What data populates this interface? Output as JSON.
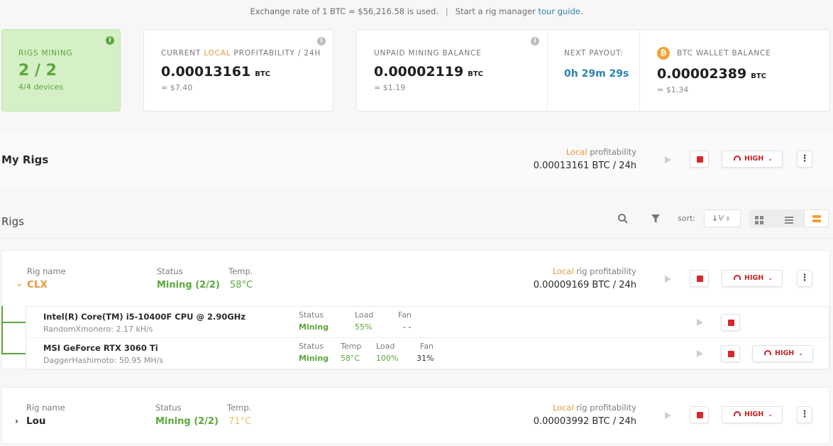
{
  "topbar": {
    "rate_text": "Exchange rate of 1 BTC ≈ $56,216.58 is used.",
    "tour_prefix": "Start a rig manager",
    "tour_link": "tour guide",
    "tour_suffix": "."
  },
  "stats": {
    "rigs_mining": {
      "label": "RIGS MINING",
      "value": "2 / 2",
      "devices": "4/4 devices"
    },
    "profitability": {
      "label_prefix": "CURRENT",
      "label_local": "LOCAL",
      "label_suffix": "PROFITABILITY / 24H",
      "value": "0.00013161",
      "unit": "BTC",
      "usd": "≈ $7.40"
    },
    "unpaid": {
      "label": "UNPAID MINING BALANCE",
      "value": "0.00002119",
      "unit": "BTC",
      "usd": "≈ $1.19"
    },
    "payout": {
      "label": "NEXT PAYOUT:",
      "value": "0h 29m 29s"
    },
    "wallet": {
      "label": "BTC WALLET BALANCE",
      "value": "0.00002389",
      "unit": "BTC",
      "usd": "≈ $1.34",
      "icon": "bitcoin-icon"
    }
  },
  "myrigs": {
    "title": "My Rigs",
    "local": "Local",
    "profit_label": "profitability",
    "profit_value": "0.00013161 BTC / 24h",
    "power": "HIGH"
  },
  "rigs_bar": {
    "title": "Rigs",
    "sort_label": "sort:"
  },
  "rigs": [
    {
      "name_label": "Rig name",
      "name": "CLX",
      "status_label": "Status",
      "status": "Mining (2/2)",
      "temp_label": "Temp.",
      "temp": "58°C",
      "local": "Local",
      "profit_label": "rig profitability",
      "profit": "0.00009169 BTC / 24h",
      "power": "HIGH",
      "devices": [
        {
          "name": "Intel(R) Core(TM) i5-10400F CPU @ 2.90GHz",
          "algo": "RandomXmonero: 2.17 kH/s",
          "status_label": "Status",
          "status": "Mining",
          "load_label": "Load",
          "load": "55%",
          "fan_label": "Fan",
          "fan": "- -"
        },
        {
          "name": "MSI GeForce RTX 3060 Ti",
          "algo": "DaggerHashimoto: 50.95 MH/s",
          "status_label": "Status",
          "status": "Mining",
          "temp_label": "Temp",
          "temp": "58°C",
          "load_label": "Load",
          "load": "100%",
          "fan_label": "Fan",
          "fan": "31%",
          "power": "HIGH"
        }
      ]
    },
    {
      "name_label": "Rig name",
      "name": "Lou",
      "status_label": "Status",
      "status": "Mining (2/2)",
      "temp_label": "Temp.",
      "temp": "71°C",
      "local": "Local",
      "profit_label": "rig profitability",
      "profit": "0.00003992 BTC / 24h",
      "power": "HIGH"
    }
  ],
  "colors": {
    "accent_green": "#5aa83b",
    "accent_orange": "#e59a3c",
    "stop_red": "#d9262a",
    "link_blue": "#2c83b3",
    "temp_hot": "#e6c36e"
  }
}
